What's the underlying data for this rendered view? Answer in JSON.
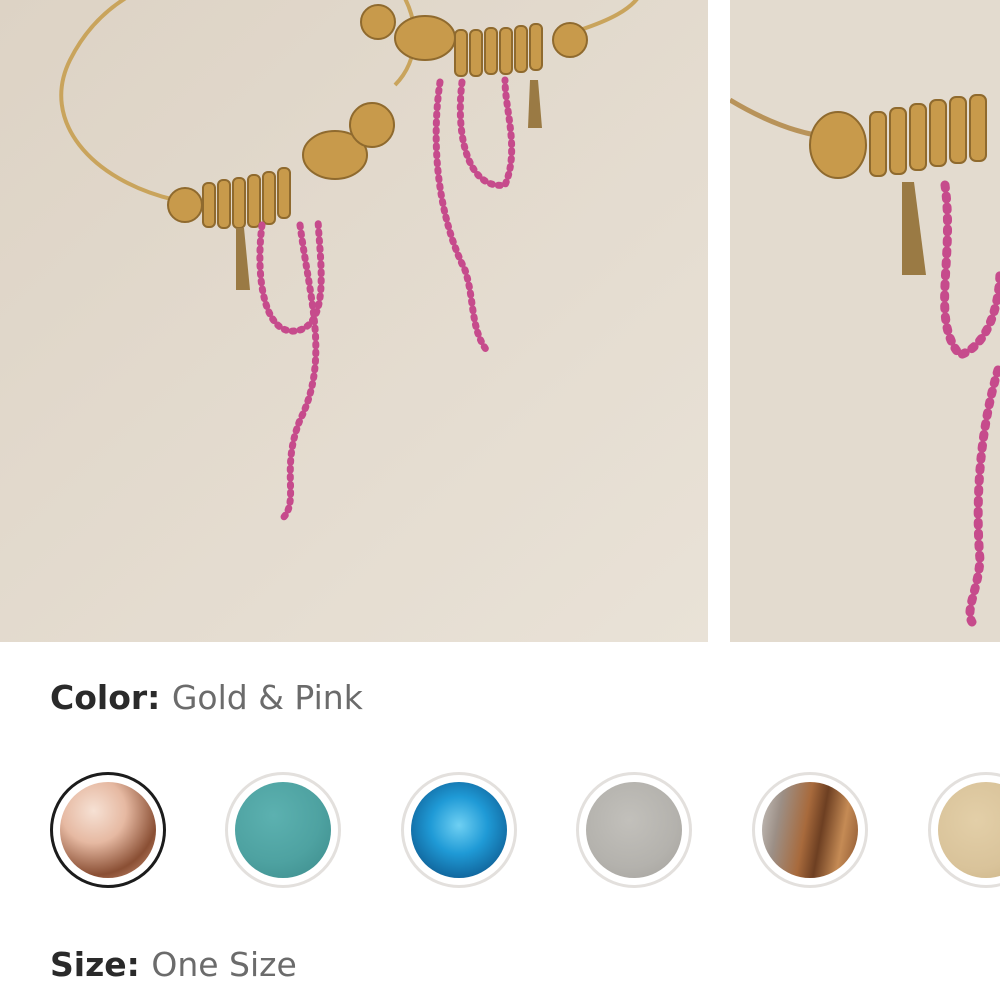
{
  "product": {
    "images": [
      {
        "name": "earrings-photo-main"
      },
      {
        "name": "earrings-photo-detail"
      }
    ]
  },
  "options": {
    "color": {
      "label": "Color:",
      "value": "Gold & Pink",
      "swatches": [
        {
          "name": "swatch-gold-pink",
          "selected": true,
          "colors": [
            "#e6b9a2",
            "#8a4f34",
            "#f3d9c8"
          ]
        },
        {
          "name": "swatch-teal",
          "selected": false,
          "colors": [
            "#4ea2a1",
            "#3b8a8a"
          ]
        },
        {
          "name": "swatch-turquoise",
          "selected": false,
          "colors": [
            "#1f9ad6",
            "#0f5f95"
          ]
        },
        {
          "name": "swatch-silver",
          "selected": false,
          "colors": [
            "#b4b2ad",
            "#a3a09b"
          ]
        },
        {
          "name": "swatch-bronze",
          "selected": false,
          "colors": [
            "#a86a3c",
            "#6d3f22"
          ]
        },
        {
          "name": "swatch-champagne",
          "selected": false,
          "colors": [
            "#d9c39a",
            "#c9b182"
          ]
        }
      ]
    },
    "size": {
      "label": "Size:",
      "value": "One Size"
    }
  }
}
